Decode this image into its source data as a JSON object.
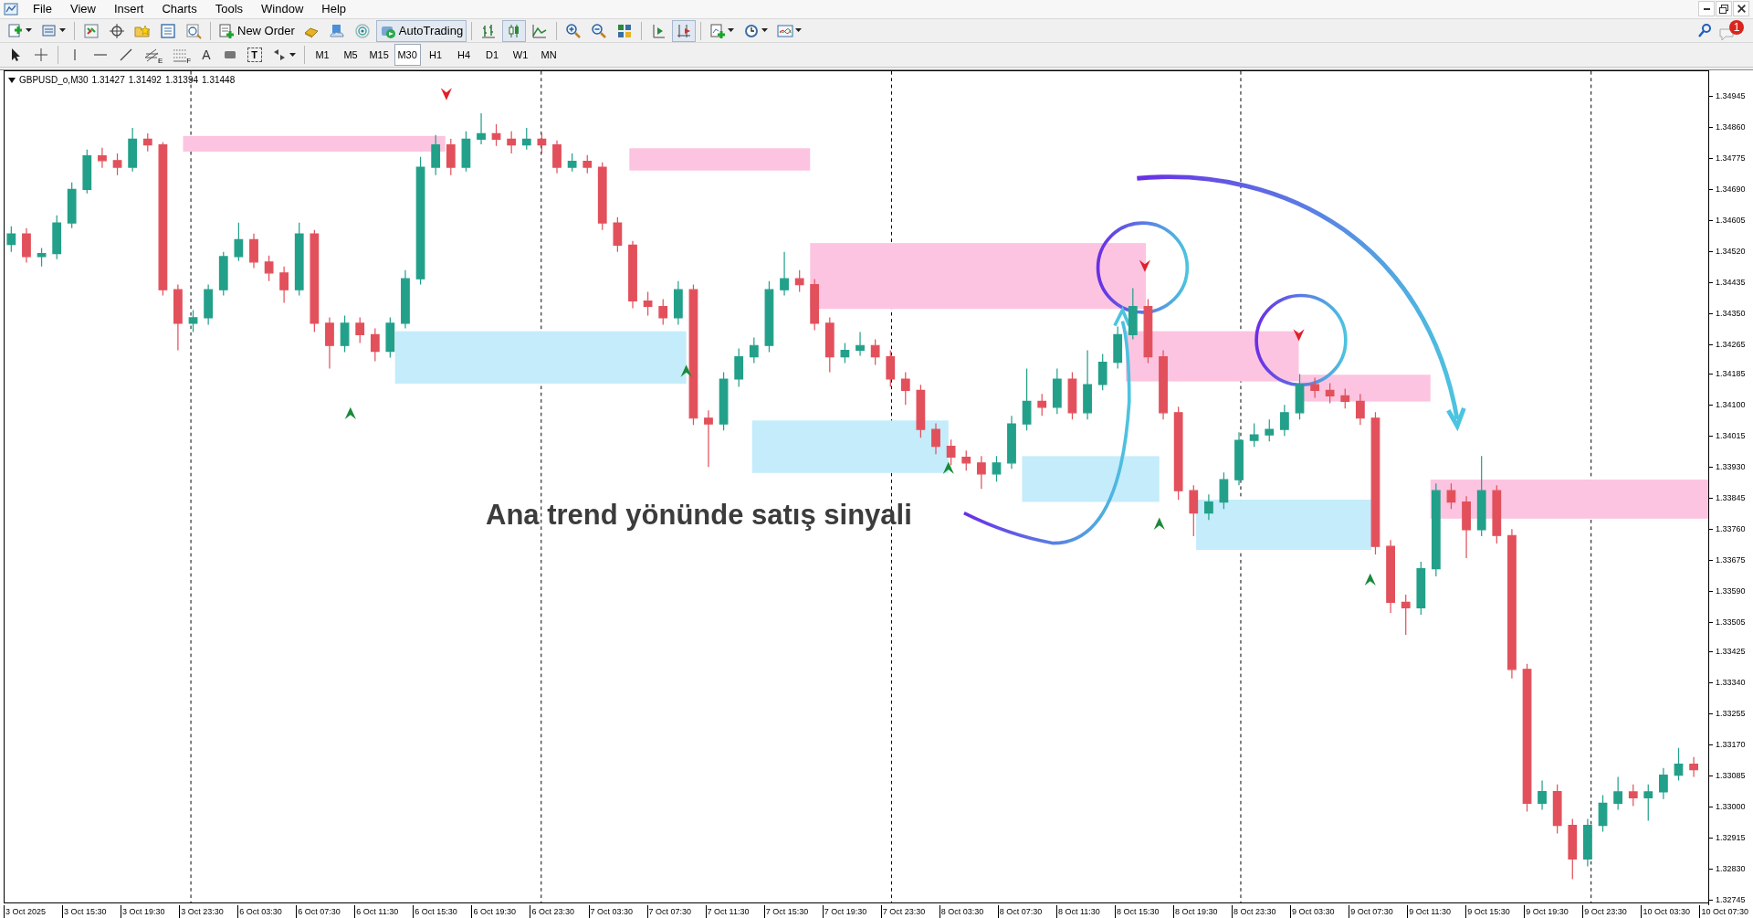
{
  "menu": [
    "File",
    "View",
    "Insert",
    "Charts",
    "Tools",
    "Window",
    "Help"
  ],
  "toolbar": {
    "new_order": "New Order",
    "auto_trading": "AutoTrading"
  },
  "drawing_tools": {
    "fibo_expansion_mark": "E",
    "fibo_fan_mark": "F",
    "text_tool": "A",
    "label_tool": "T"
  },
  "timeframes": [
    {
      "label": "M1",
      "selected": false
    },
    {
      "label": "M5",
      "selected": false
    },
    {
      "label": "M15",
      "selected": false
    },
    {
      "label": "M30",
      "selected": true
    },
    {
      "label": "H1",
      "selected": false
    },
    {
      "label": "H4",
      "selected": false
    },
    {
      "label": "D1",
      "selected": false
    },
    {
      "label": "W1",
      "selected": false
    },
    {
      "label": "MN",
      "selected": false
    }
  ],
  "notifications": {
    "count": "1"
  },
  "chart": {
    "header": {
      "symbol": "GBPUSD_o,M30",
      "open": "1.31427",
      "high": "1.31492",
      "low": "1.31394",
      "close": "1.31448"
    },
    "annotation": "Ana trend yönünde satış sinyali",
    "time_axis": [
      "3 Oct 2025",
      "3 Oct 15:30",
      "3 Oct 19:30",
      "3 Oct 23:30",
      "6 Oct 03:30",
      "6 Oct 07:30",
      "6 Oct 11:30",
      "6 Oct 15:30",
      "6 Oct 19:30",
      "6 Oct 23:30",
      "7 Oct 03:30",
      "7 Oct 07:30",
      "7 Oct 11:30",
      "7 Oct 15:30",
      "7 Oct 19:30",
      "7 Oct 23:30",
      "8 Oct 03:30",
      "8 Oct 07:30",
      "8 Oct 11:30",
      "8 Oct 15:30",
      "8 Oct 19:30",
      "8 Oct 23:30",
      "9 Oct 03:30",
      "9 Oct 07:30",
      "9 Oct 11:30",
      "9 Oct 15:30",
      "9 Oct 19:30",
      "9 Oct 23:30",
      "10 Oct 03:30",
      "10 Oct 07:30"
    ],
    "chart_data": {
      "type": "candlestick",
      "ylim": [
        1.32736,
        1.35015
      ],
      "yticks": [
        {
          "value": 1.34945,
          "label": "1.34945"
        },
        {
          "value": 1.3486,
          "label": "1.34860"
        },
        {
          "value": 1.34775,
          "label": "1.34775"
        },
        {
          "value": 1.3469,
          "label": "1.34690"
        },
        {
          "value": 1.34605,
          "label": "1.34605"
        },
        {
          "value": 1.3452,
          "label": "1.34520"
        },
        {
          "value": 1.34435,
          "label": "1.34435"
        },
        {
          "value": 1.3435,
          "label": "1.34350"
        },
        {
          "value": 1.34265,
          "label": "1.34265"
        },
        {
          "value": 1.34185,
          "label": "1.34185"
        },
        {
          "value": 1.341,
          "label": "1.34100"
        },
        {
          "value": 1.34015,
          "label": "1.34015"
        },
        {
          "value": 1.3393,
          "label": "1.33930"
        },
        {
          "value": 1.33845,
          "label": "1.33845"
        },
        {
          "value": 1.3376,
          "label": "1.33760"
        },
        {
          "value": 1.33675,
          "label": "1.33675"
        },
        {
          "value": 1.3359,
          "label": "1.33590"
        },
        {
          "value": 1.33505,
          "label": "1.33505"
        },
        {
          "value": 1.33425,
          "label": "1.33425"
        },
        {
          "value": 1.3334,
          "label": "1.33340"
        },
        {
          "value": 1.33255,
          "label": "1.33255"
        },
        {
          "value": 1.3317,
          "label": "1.33170"
        },
        {
          "value": 1.33085,
          "label": "1.33085"
        },
        {
          "value": 1.33,
          "label": "1.33000"
        },
        {
          "value": 1.32915,
          "label": "1.32915"
        },
        {
          "value": 1.3283,
          "label": "1.32830"
        },
        {
          "value": 1.32745,
          "label": "1.32745"
        }
      ],
      "categories": [
        null,
        null,
        null,
        null,
        null,
        null,
        null,
        null,
        null,
        null,
        null,
        null,
        null,
        null,
        null,
        null,
        null,
        null,
        null,
        null,
        null,
        null,
        null,
        null,
        null,
        null,
        null,
        null,
        null,
        null,
        null,
        null,
        null,
        null,
        null,
        null,
        null,
        null,
        null,
        null,
        null,
        null,
        null,
        null,
        null,
        null,
        null,
        null,
        null,
        null,
        null,
        null,
        null,
        null,
        null,
        null,
        null,
        null,
        null,
        null,
        null,
        null,
        null,
        null,
        null,
        null,
        null,
        null,
        null,
        null,
        null,
        null,
        null,
        null,
        null,
        null,
        null,
        null,
        null,
        null,
        null,
        null,
        null,
        null,
        null,
        null,
        null,
        null,
        null,
        null,
        null,
        null,
        null,
        null,
        null,
        null,
        null,
        null,
        null,
        null,
        null,
        null,
        null,
        null,
        null,
        null,
        null,
        null,
        null,
        null,
        null,
        null
      ],
      "ohlc": [
        [
          1.3454,
          1.3459,
          1.3452,
          1.34569
        ],
        [
          1.34569,
          1.34585,
          1.3449,
          1.34507
        ],
        [
          1.34507,
          1.3453,
          1.3448,
          1.34515
        ],
        [
          1.34515,
          1.3462,
          1.345,
          1.34599
        ],
        [
          1.34599,
          1.3471,
          1.34585,
          1.34691
        ],
        [
          1.34691,
          1.348,
          1.3468,
          1.34783
        ],
        [
          1.34783,
          1.34805,
          1.3475,
          1.3477
        ],
        [
          1.3477,
          1.3479,
          1.3473,
          1.34752
        ],
        [
          1.34752,
          1.3486,
          1.3474,
          1.34829
        ],
        [
          1.34829,
          1.34845,
          1.34795,
          1.34813
        ],
        [
          1.34813,
          1.3482,
          1.344,
          1.34416
        ],
        [
          1.34416,
          1.3443,
          1.3425,
          1.34324
        ],
        [
          1.34324,
          1.3436,
          1.343,
          1.34339
        ],
        [
          1.34339,
          1.3443,
          1.3432,
          1.34416
        ],
        [
          1.34416,
          1.3452,
          1.344,
          1.34507
        ],
        [
          1.34507,
          1.346,
          1.34495,
          1.34553
        ],
        [
          1.34553,
          1.3457,
          1.34475,
          1.34492
        ],
        [
          1.34492,
          1.3451,
          1.3444,
          1.34462
        ],
        [
          1.34462,
          1.3448,
          1.3438,
          1.34416
        ],
        [
          1.34416,
          1.346,
          1.344,
          1.34569
        ],
        [
          1.34569,
          1.3458,
          1.343,
          1.34324
        ],
        [
          1.34324,
          1.3434,
          1.342,
          1.34263
        ],
        [
          1.34263,
          1.34345,
          1.34245,
          1.34324
        ],
        [
          1.34324,
          1.3434,
          1.3427,
          1.34293
        ],
        [
          1.34293,
          1.3431,
          1.3422,
          1.34247
        ],
        [
          1.34247,
          1.3434,
          1.3423,
          1.34324
        ],
        [
          1.34324,
          1.3447,
          1.3431,
          1.34446
        ],
        [
          1.34446,
          1.3478,
          1.3443,
          1.34752
        ],
        [
          1.34752,
          1.3484,
          1.3473,
          1.34813
        ],
        [
          1.34813,
          1.3483,
          1.3473,
          1.34752
        ],
        [
          1.34752,
          1.3485,
          1.3474,
          1.34829
        ],
        [
          1.34829,
          1.349,
          1.34815,
          1.34844
        ],
        [
          1.34844,
          1.3487,
          1.3481,
          1.34829
        ],
        [
          1.34829,
          1.3485,
          1.3479,
          1.34813
        ],
        [
          1.34813,
          1.3486,
          1.348,
          1.34829
        ],
        [
          1.34829,
          1.34845,
          1.3479,
          1.34813
        ],
        [
          1.34813,
          1.34825,
          1.34735,
          1.34752
        ],
        [
          1.34752,
          1.3479,
          1.3474,
          1.34768
        ],
        [
          1.34768,
          1.34785,
          1.34735,
          1.34752
        ],
        [
          1.34752,
          1.34765,
          1.3458,
          1.34599
        ],
        [
          1.34599,
          1.34615,
          1.3452,
          1.34538
        ],
        [
          1.34538,
          1.3455,
          1.34365,
          1.34385
        ],
        [
          1.34385,
          1.3441,
          1.34345,
          1.3437
        ],
        [
          1.3437,
          1.3439,
          1.3432,
          1.34339
        ],
        [
          1.34339,
          1.3444,
          1.3432,
          1.34416
        ],
        [
          1.34416,
          1.3443,
          1.34045,
          1.34064
        ],
        [
          1.34064,
          1.34085,
          1.3393,
          1.34048
        ],
        [
          1.34048,
          1.3419,
          1.3403,
          1.34171
        ],
        [
          1.34171,
          1.34255,
          1.3415,
          1.34232
        ],
        [
          1.34232,
          1.34285,
          1.34215,
          1.34263
        ],
        [
          1.34263,
          1.3444,
          1.34245,
          1.34416
        ],
        [
          1.34416,
          1.3452,
          1.344,
          1.34446
        ],
        [
          1.34446,
          1.3447,
          1.3441,
          1.3443
        ],
        [
          1.3443,
          1.34445,
          1.34305,
          1.34324
        ],
        [
          1.34324,
          1.3434,
          1.3419,
          1.34232
        ],
        [
          1.34232,
          1.3427,
          1.34215,
          1.3425
        ],
        [
          1.3425,
          1.343,
          1.34235,
          1.34263
        ],
        [
          1.34263,
          1.3428,
          1.3421,
          1.34232
        ],
        [
          1.34232,
          1.3425,
          1.3415,
          1.34171
        ],
        [
          1.34171,
          1.3419,
          1.341,
          1.3414
        ],
        [
          1.3414,
          1.34155,
          1.3401,
          1.34033
        ],
        [
          1.34033,
          1.3405,
          1.33965,
          1.33987
        ],
        [
          1.33987,
          1.34005,
          1.33935,
          1.33957
        ],
        [
          1.33957,
          1.33975,
          1.3392,
          1.33941
        ],
        [
          1.33941,
          1.3396,
          1.3387,
          1.33911
        ],
        [
          1.33911,
          1.3396,
          1.3389,
          1.33941
        ],
        [
          1.33941,
          1.3407,
          1.33925,
          1.34048
        ],
        [
          1.34048,
          1.342,
          1.3403,
          1.3411
        ],
        [
          1.3411,
          1.3413,
          1.3407,
          1.34094
        ],
        [
          1.34094,
          1.342,
          1.34075,
          1.34171
        ],
        [
          1.34171,
          1.3419,
          1.3406,
          1.34079
        ],
        [
          1.34079,
          1.3425,
          1.3406,
          1.34156
        ],
        [
          1.34156,
          1.3424,
          1.3414,
          1.34217
        ],
        [
          1.34217,
          1.34315,
          1.342,
          1.34293
        ],
        [
          1.34293,
          1.3442,
          1.3428,
          1.3437
        ],
        [
          1.3437,
          1.3439,
          1.34215,
          1.34232
        ],
        [
          1.34232,
          1.3425,
          1.3406,
          1.34079
        ],
        [
          1.34079,
          1.34095,
          1.3384,
          1.33865
        ],
        [
          1.33865,
          1.3388,
          1.3374,
          1.33804
        ],
        [
          1.33804,
          1.33855,
          1.33785,
          1.33834
        ],
        [
          1.33834,
          1.33915,
          1.33815,
          1.33895
        ],
        [
          1.33895,
          1.34025,
          1.3388,
          1.34003
        ],
        [
          1.34003,
          1.3405,
          1.33985,
          1.34018
        ],
        [
          1.34018,
          1.3406,
          1.34,
          1.34033
        ],
        [
          1.34033,
          1.341,
          1.34015,
          1.34079
        ],
        [
          1.34079,
          1.34185,
          1.3406,
          1.34156
        ],
        [
          1.34156,
          1.34175,
          1.3412,
          1.3414
        ],
        [
          1.3414,
          1.3416,
          1.34105,
          1.34125
        ],
        [
          1.34125,
          1.34145,
          1.3409,
          1.3411
        ],
        [
          1.3411,
          1.3413,
          1.34045,
          1.34064
        ],
        [
          1.34064,
          1.3408,
          1.3369,
          1.33712
        ],
        [
          1.33712,
          1.3373,
          1.3353,
          1.33559
        ],
        [
          1.33559,
          1.3358,
          1.3347,
          1.33544
        ],
        [
          1.33544,
          1.3367,
          1.33525,
          1.33651
        ],
        [
          1.33651,
          1.33885,
          1.3363,
          1.33865
        ],
        [
          1.33865,
          1.33885,
          1.33815,
          1.33834
        ],
        [
          1.33834,
          1.3385,
          1.3368,
          1.33758
        ],
        [
          1.33758,
          1.3396,
          1.3374,
          1.33865
        ],
        [
          1.33865,
          1.3388,
          1.3372,
          1.33742
        ],
        [
          1.33742,
          1.3376,
          1.3335,
          1.33375
        ],
        [
          1.33375,
          1.3339,
          1.32985,
          1.33008
        ],
        [
          1.33008,
          1.3307,
          1.3299,
          1.3304
        ],
        [
          1.3304,
          1.3306,
          1.32925,
          1.32947
        ],
        [
          1.32947,
          1.32965,
          1.328,
          1.32855
        ],
        [
          1.32855,
          1.32965,
          1.32835,
          1.32947
        ],
        [
          1.32947,
          1.3303,
          1.3293,
          1.33008
        ],
        [
          1.33008,
          1.3308,
          1.3299,
          1.33039
        ],
        [
          1.33039,
          1.3306,
          1.33,
          1.33023
        ],
        [
          1.33023,
          1.3306,
          1.3296,
          1.33039
        ],
        [
          1.33039,
          1.33105,
          1.3302,
          1.33085
        ],
        [
          1.33085,
          1.3316,
          1.3307,
          1.33115
        ],
        [
          1.33115,
          1.33135,
          1.3308,
          1.331
        ]
      ]
    }
  }
}
